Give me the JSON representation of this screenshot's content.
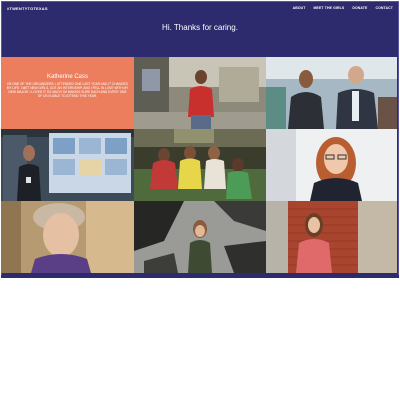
{
  "header": {
    "brand": "#TWENTYTOTEXAS",
    "nav": [
      "ABOUT",
      "MEET THE GIRLS",
      "DONATE",
      "CONTACT"
    ]
  },
  "hero": {
    "title": "Hi. Thanks for caring."
  },
  "featured": {
    "name": "Katherine Cass",
    "quote": "I'm one of the organizers. I attended one last year and it changed my life. I met new girls, got an internship, and I fell in love with my new major. I loved it so much I'm making sure each and every one of us is able to attend this year."
  },
  "colors": {
    "header_bg": "#2d2a6e",
    "featured_bg": "#ec7e5e",
    "text": "#ffffff"
  },
  "photos": [
    "photo-woman-red-jacket",
    "photo-woman-and-man-outdoors",
    "photo-woman-research-poster",
    "photo-group-of-students",
    "photo-woman-glasses-smiling",
    "photo-woman-short-hair-selfie",
    "photo-woman-by-mural",
    "photo-woman-by-brick-wall"
  ]
}
